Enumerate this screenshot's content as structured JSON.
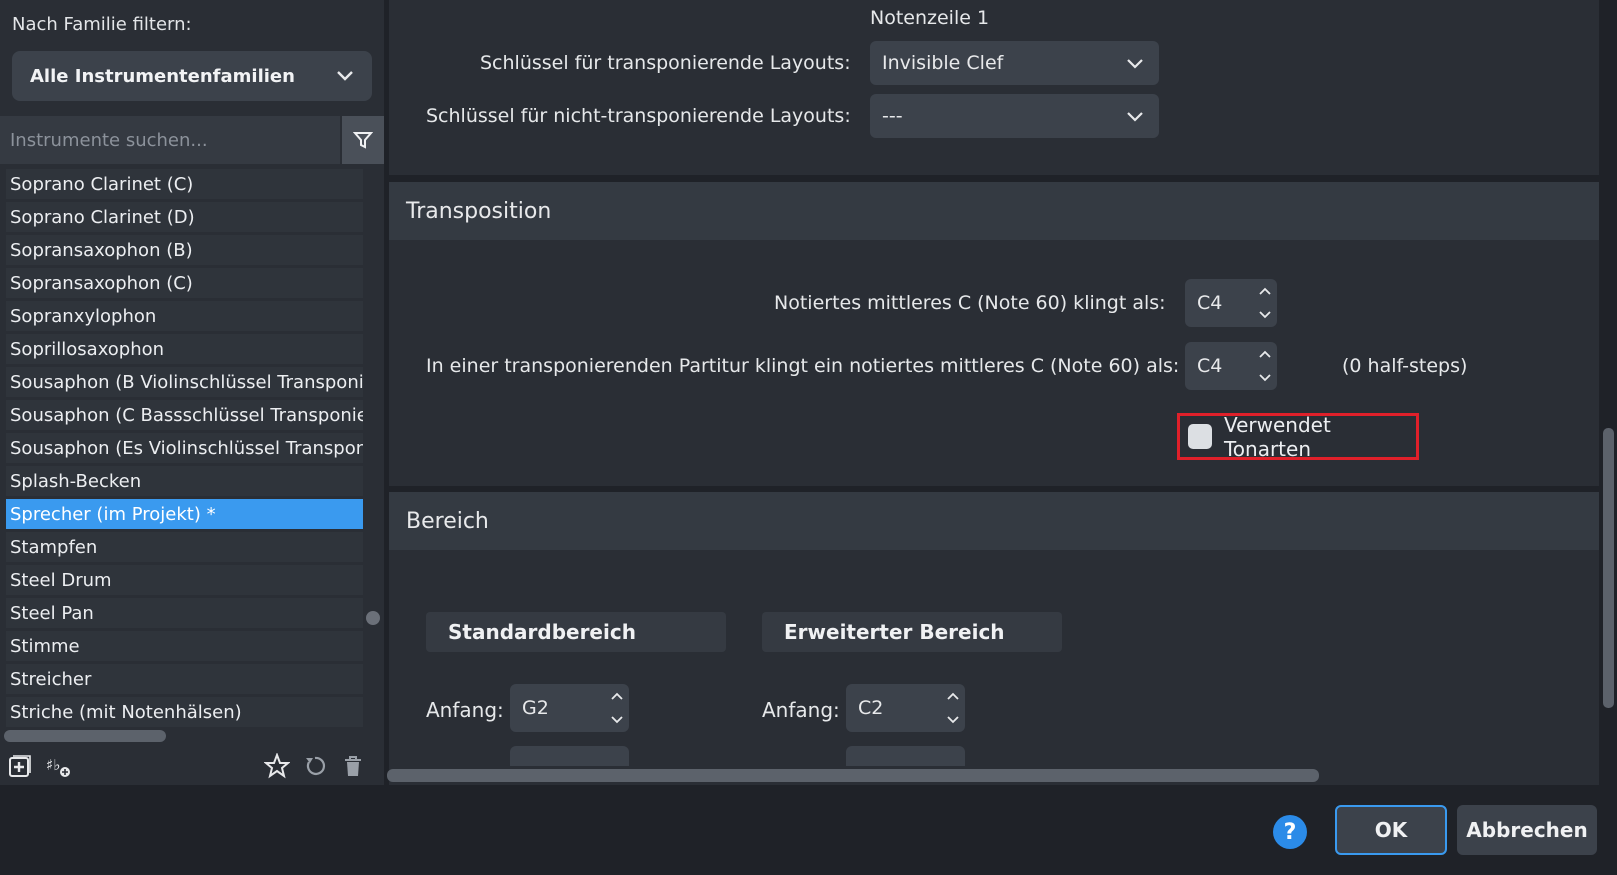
{
  "left": {
    "family_label": "Nach Familie filtern:",
    "family_select": "Alle Instrumentenfamilien",
    "search_placeholder": "Instrumente suchen...",
    "instruments": [
      "Soprano Clarinet (C)",
      "Soprano Clarinet (D)",
      "Sopransaxophon (B)",
      "Sopransaxophon (C)",
      "Sopranxylophon",
      "Soprillosaxophon",
      "Sousaphon (B Violinschlüssel Transponier",
      "Sousaphon (C Bassschlüssel Transponierte",
      "Sousaphon (Es Violinschlüssel Transponie",
      "Splash-Becken",
      "Sprecher (im Projekt) *",
      "Stampfen",
      "Steel Drum",
      "Steel Pan",
      "Stimme",
      "Streicher",
      "Striche (mit Notenhälsen)"
    ],
    "selected_index": 10
  },
  "clefs": {
    "staff_label": "Notenzeile 1",
    "transposing_label": "Schlüssel für transponierende Layouts:",
    "transposing_value": "Invisible Clef",
    "concert_label": "Schlüssel für nicht-transponierende Layouts:",
    "concert_value": "---"
  },
  "transposition": {
    "title": "Transposition",
    "written_c_label": "Notiertes mittleres C (Note 60) klingt als:",
    "written_c_value": "C4",
    "transposing_score_label": "In einer transponierenden Partitur klingt ein notiertes mittleres C (Note 60) als:",
    "transposing_score_value": "C4",
    "half_steps": "(0 half-steps)",
    "uses_keys_label": "Verwendet Tonarten"
  },
  "range": {
    "title": "Bereich",
    "standard_title": "Standardbereich",
    "extended_title": "Erweiterter Bereich",
    "start_label": "Anfang:",
    "standard_start": "G2",
    "extended_start": "C2"
  },
  "footer": {
    "help": "?",
    "ok": "OK",
    "cancel": "Abbrechen"
  }
}
